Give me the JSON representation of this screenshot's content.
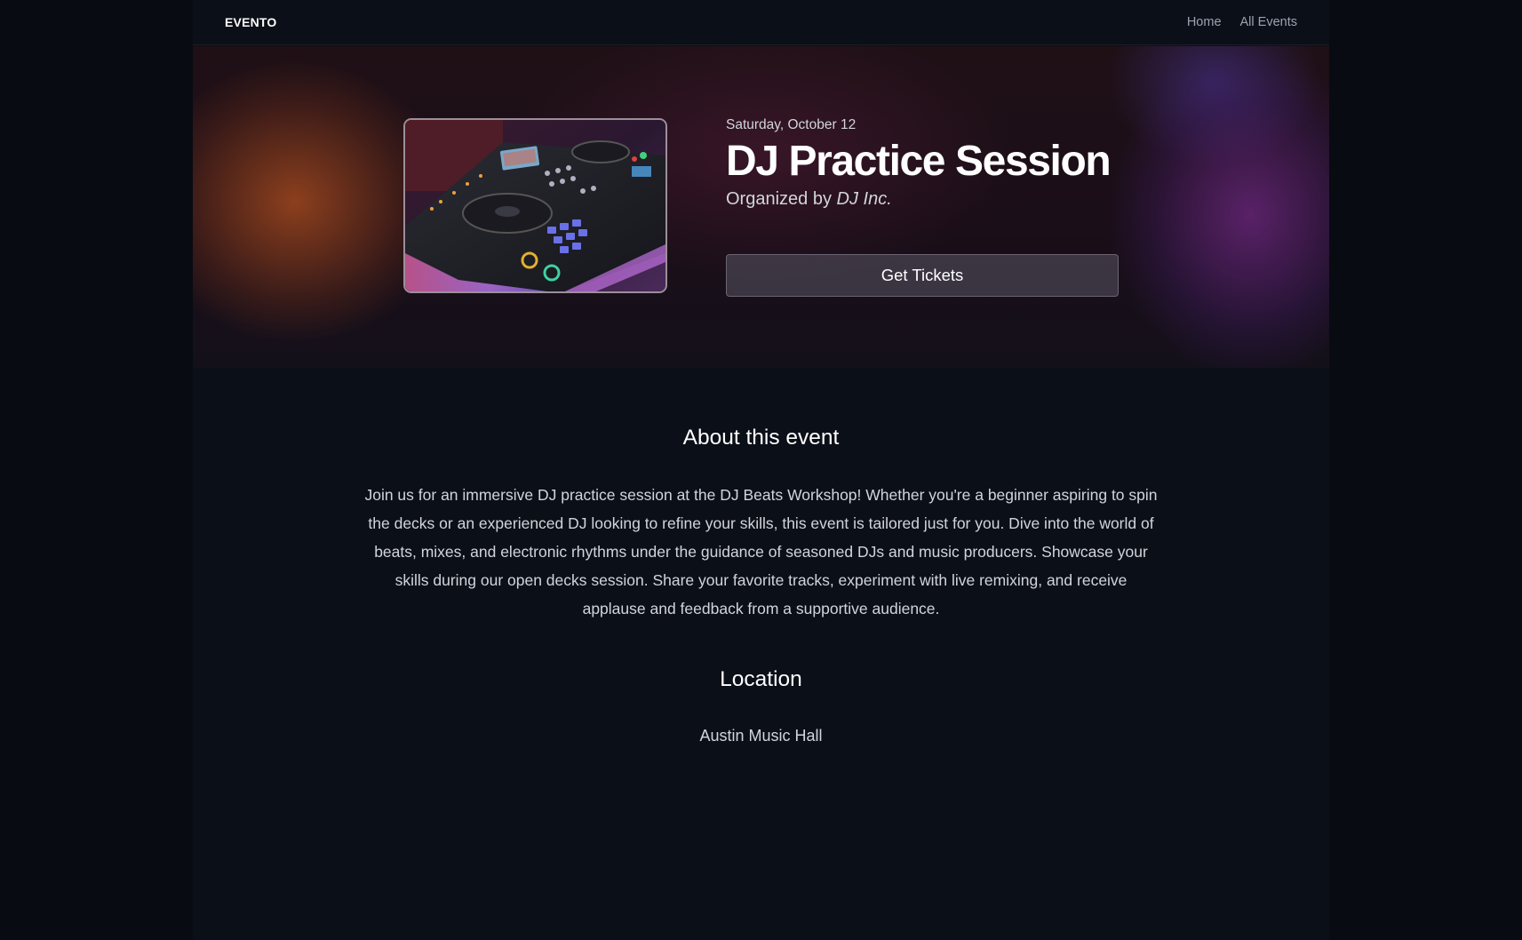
{
  "nav": {
    "brand": "EVENTO",
    "links": [
      "Home",
      "All Events"
    ]
  },
  "hero": {
    "image_alt": "DJ controller",
    "date": "Saturday, October 12",
    "title": "DJ Practice Session",
    "organizer_prefix": "Organized by",
    "organizer_name": "DJ Inc.",
    "cta_label": "Get Tickets"
  },
  "about": {
    "heading": "About this event",
    "text": "Join us for an immersive DJ practice session at the DJ Beats Workshop! Whether you're a beginner aspiring to spin the decks or an experienced DJ looking to refine your skills, this event is tailored just for you. Dive into the world of beats, mixes, and electronic rhythms under the guidance of seasoned DJs and music producers. Showcase your skills during our open decks session. Share your favorite tracks, experiment with live remixing, and receive applause and feedback from a supportive audience."
  },
  "location": {
    "heading": "Location",
    "venue": "Austin Music Hall"
  },
  "colors": {
    "page_bg": "#080b12",
    "content_bg": "#0b0f18",
    "hero_orange": "#a0481e",
    "hero_purple": "#6e2882",
    "text_primary": "#ffffff",
    "text_secondary": "#d1d5db",
    "nav_link": "#9ca3af"
  }
}
